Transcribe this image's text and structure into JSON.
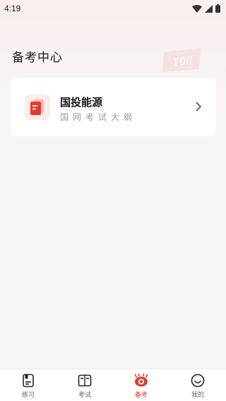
{
  "status_bar": {
    "time": "4:19"
  },
  "header": {
    "title": "备考中心",
    "watermark_text": "100"
  },
  "card": {
    "title": "国投能源",
    "subtitle": "国网考试大纲",
    "icon": "document-icon",
    "accent_color": "#e8392d"
  },
  "bottom_nav": {
    "active_color": "#e33b2e",
    "items": [
      {
        "label": "练习",
        "icon": "practice-icon",
        "active": false
      },
      {
        "label": "考试",
        "icon": "exam-icon",
        "active": false
      },
      {
        "label": "备考",
        "icon": "prepare-eye-icon",
        "active": true
      },
      {
        "label": "我的",
        "icon": "smiley-icon",
        "active": false
      }
    ]
  }
}
